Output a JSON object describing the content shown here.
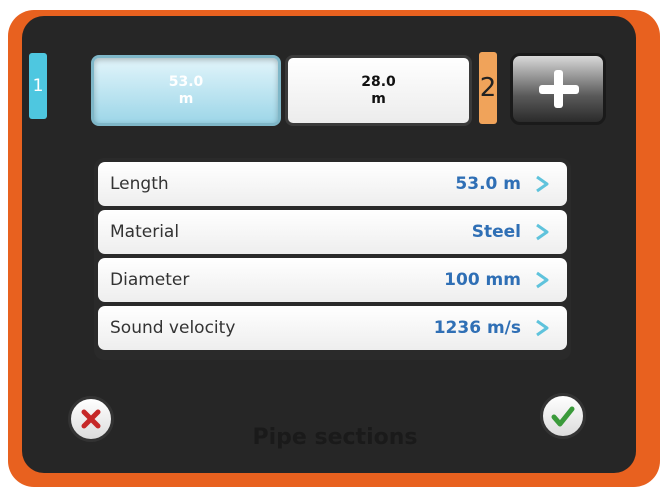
{
  "sections": {
    "tab1": {
      "number": "1",
      "length_value": "53.0",
      "length_unit": "m"
    },
    "tab2": {
      "number": "2",
      "length_value": "28.0",
      "length_unit": "m"
    }
  },
  "properties": [
    {
      "label": "Length",
      "value": "53.0 m"
    },
    {
      "label": "Material",
      "value": "Steel"
    },
    {
      "label": "Diameter",
      "value": "100 mm"
    },
    {
      "label": "Sound velocity",
      "value": "1236 m/s"
    }
  ],
  "footer": {
    "title": "Pipe sections"
  },
  "icons": [
    "plus-icon",
    "chevron-right-icon",
    "close-icon",
    "check-icon"
  ],
  "colors": {
    "frame": "#e8611f",
    "accent_blue": "#4ec7e0",
    "accent_orange": "#f0a35a",
    "value_text": "#2f6fb5",
    "cancel": "#c62828",
    "confirm": "#3a9a3a"
  }
}
